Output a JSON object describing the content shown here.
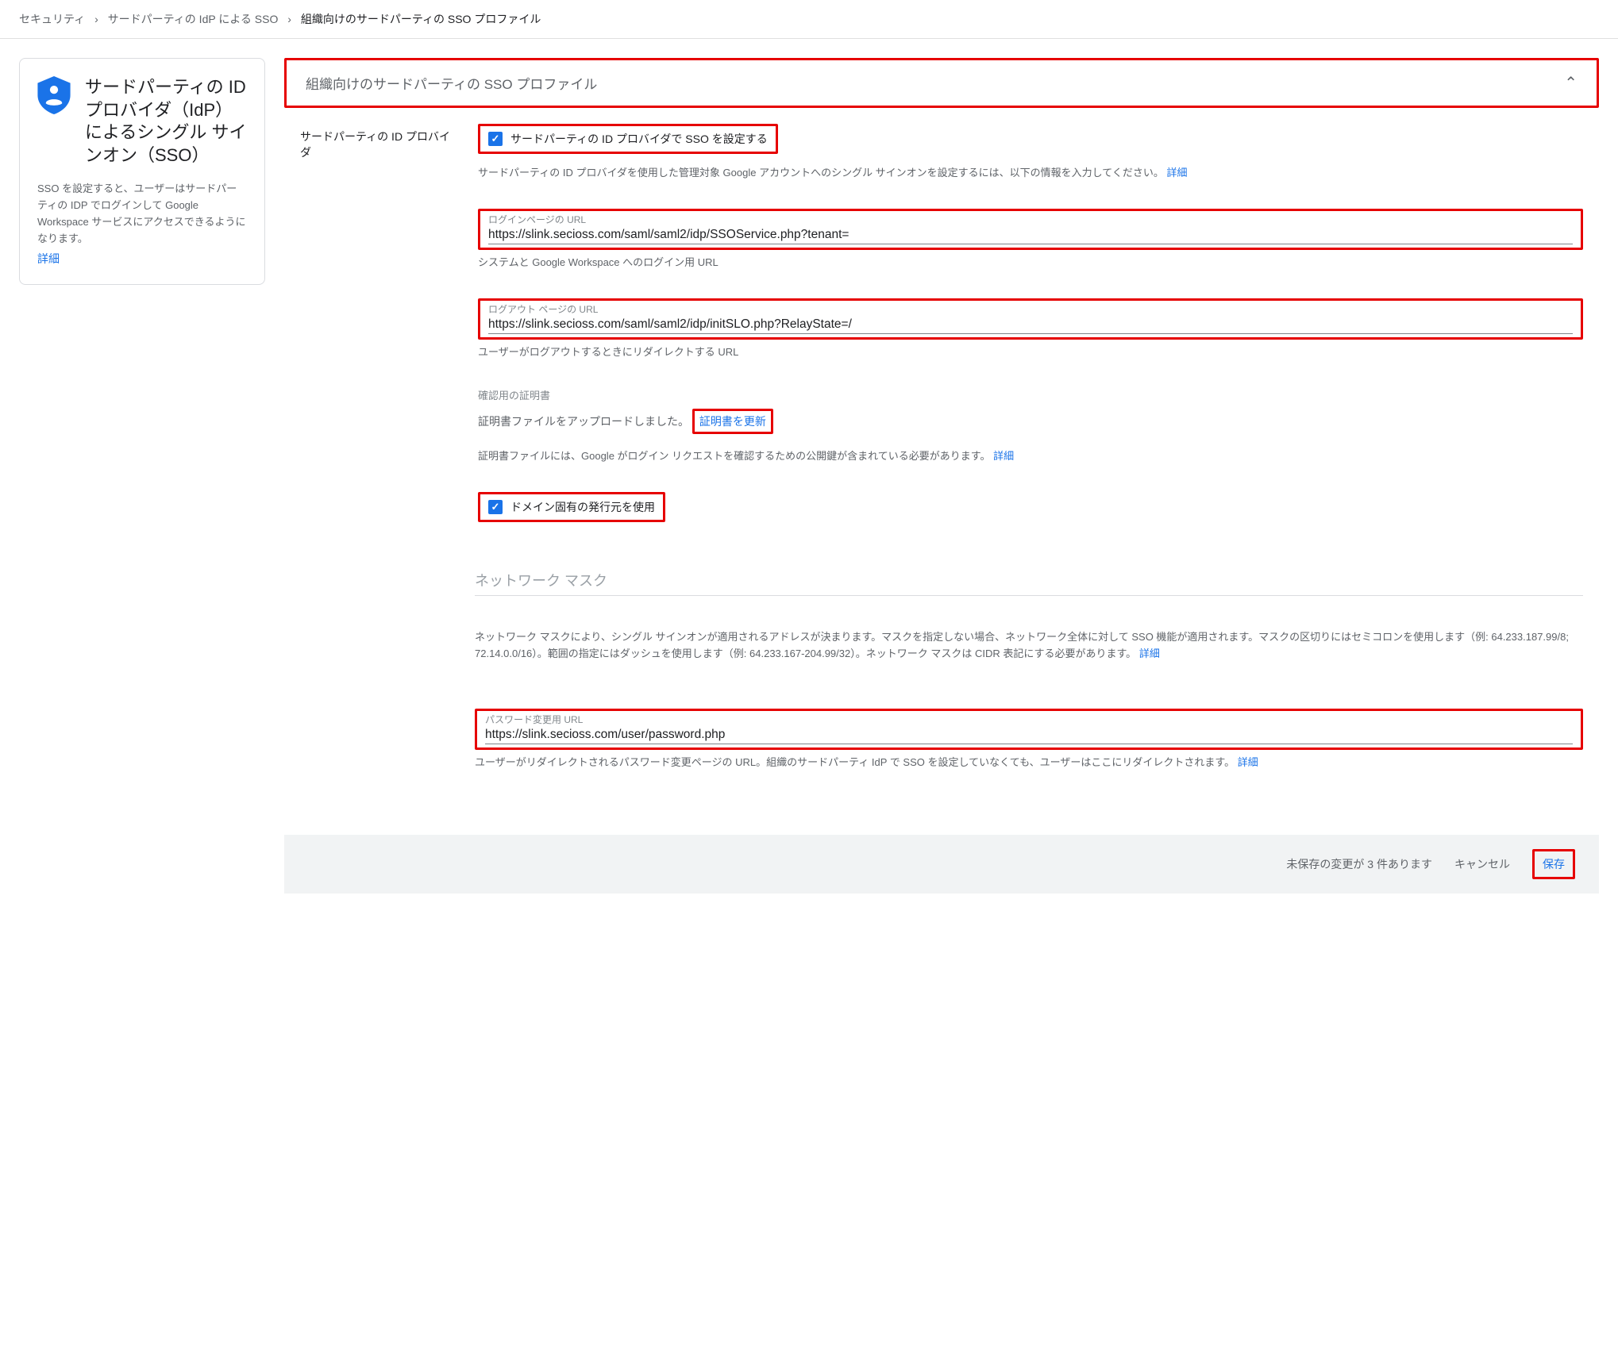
{
  "breadcrumb": {
    "0": "セキュリティ",
    "1": "サードパーティの IdP による SSO",
    "2": "組織向けのサードパーティの SSO プロファイル"
  },
  "side": {
    "title": "サードパーティの ID プロバイダ（IdP）によるシングル サインオン（SSO）",
    "desc": "SSO を設定すると、ユーザーはサードパーティの IDP でログインして Google Workspace サービスにアクセスできるようになります。",
    "more": "詳細"
  },
  "header": {
    "title": "組織向けのサードパーティの SSO プロファイル"
  },
  "idp": {
    "label": "サードパーティの ID プロバイダ",
    "checkboxLabel": "サードパーティの ID プロバイダで SSO を設定する",
    "helper1": "サードパーティの ID プロバイダを使用した管理対象 Google アカウントへのシングル サインオンを設定するには、以下の情報を入力してください。",
    "more": "詳細"
  },
  "loginUrl": {
    "label": "ログインページの URL",
    "value": "https://slink.secioss.com/saml/saml2/idp/SSOService.php?tenant=",
    "helper": "システムと Google Workspace へのログイン用 URL"
  },
  "logoutUrl": {
    "label": "ログアウト ページの URL",
    "value": "https://slink.secioss.com/saml/saml2/idp/initSLO.php?RelayState=/",
    "helper": "ユーザーがログアウトするときにリダイレクトする URL"
  },
  "cert": {
    "label": "確認用の証明書",
    "uploaded": "証明書ファイルをアップロードしました。",
    "update": "証明書を更新",
    "helper": "証明書ファイルには、Google がログイン リクエストを確認するための公開鍵が含まれている必要があります。",
    "more": "詳細"
  },
  "domainIssuer": {
    "label": "ドメイン固有の発行元を使用"
  },
  "netmask": {
    "title": "ネットワーク マスク",
    "desc": "ネットワーク マスクにより、シングル サインオンが適用されるアドレスが決まります。マスクを指定しない場合、ネットワーク全体に対して SSO 機能が適用されます。マスクの区切りにはセミコロンを使用します（例: 64.233.187.99/8; 72.14.0.0/16）。範囲の指定にはダッシュを使用します（例: 64.233.167-204.99/32）。ネットワーク マスクは CIDR 表記にする必要があります。",
    "more": "詳細"
  },
  "pwUrl": {
    "label": "パスワード変更用 URL",
    "value": "https://slink.secioss.com/user/password.php",
    "helper": "ユーザーがリダイレクトされるパスワード変更ページの URL。組織のサードパーティ IdP で SSO を設定していなくても、ユーザーはここにリダイレクトされます。",
    "more": "詳細"
  },
  "footer": {
    "unsaved": "未保存の変更が 3 件あります",
    "cancel": "キャンセル",
    "save": "保存"
  }
}
